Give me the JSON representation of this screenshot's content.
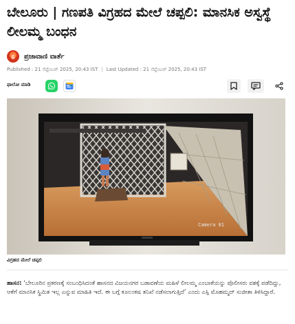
{
  "article": {
    "headline": "ಬೇಲೂರು | ಗಣಪತಿ ವಿಗ್ರಹದ ಮೇಲೆ ಚಪ್ಪಲಿ: ಮಾನಸಿಕ ಅಸ್ವಸ್ಥೆ ಲೀಲಮ್ಮ ಬಂಧನ",
    "author": "ಪ್ರಜಾವಾಣಿ ವಾರ್ತೆ",
    "avatar_text": "ಪ್ರ",
    "published": "Published : 21 ಸೆಪ್ಟೆಂಬರ್ 2025, 20:43 IST",
    "separator": "|",
    "updated": "Last Updated : 21 ಸೆಪ್ಟೆಂಬರ್ 2025, 20:43 IST",
    "follow_label": "ಫಾಲೋ ಮಾಡಿ",
    "image_caption": "ವಿಗ್ರಹದ ಮೇಲೆ ಚಪ್ಪಲಿ",
    "dateline": "ಹಾಸನ:",
    "body": " ‘ಬೇಲೂರಿನ ಪ್ರಕರಣಕ್ಕೆ ಸಂಬಂಧಿಸಿದಂತೆ ಹಾಸನದ ವಿಜಯನಗರ ಬಡಾವಣೆಯ ಮಹಿಳೆ ಲೀಲಮ್ಮ ಎಂಬಾಕೆಯನ್ನು ಪೊಲೀಸರು ವಶಕ್ಕೆ ಪಡೆದಿದ್ದು, ಆಕೆಗೆ ಮಾನಸಿಕ ಸ್ಥಿಮಿತ ಇಲ್ಲ ಎನ್ನುವ ಮಾಹಿತಿ ಇದೆ. ಈ ಬಗ್ಗೆ ಕೂಲಂಕಷ ತನಿಖೆ ನಡೆಸಲಾಗುತ್ತಿದೆ’ ಎಂದು ಎಸ್ಪಿ ಮೊಹಮ್ಮದ್ ಸುಜೀತಾ ತಿಳಿಸಿದ್ದಾರೆ.",
    "camera_label": "Camera 01"
  },
  "icons": {
    "whatsapp": "whatsapp-icon",
    "google_news": "google-news-icon",
    "bookmark": "bookmark-icon",
    "comments": "comments-icon",
    "share": "share-icon"
  },
  "colors": {
    "whatsapp": "#25d366",
    "brand": "#d2341c",
    "text": "#111111",
    "meta": "#777777"
  }
}
